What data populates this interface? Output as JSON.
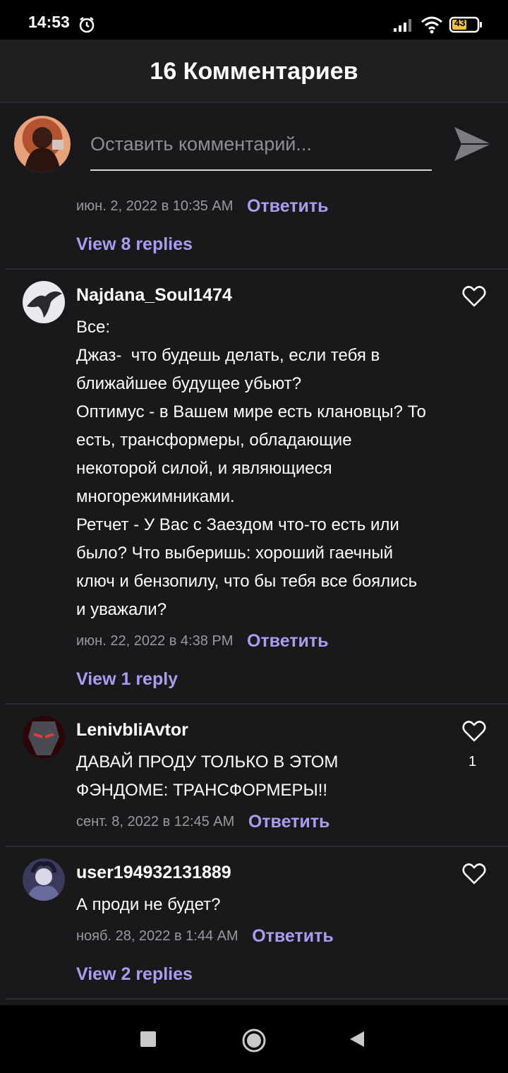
{
  "status_bar": {
    "time": "14:53",
    "battery": "43",
    "icons": [
      "alarm-icon",
      "signal-icon",
      "wifi-icon",
      "battery-icon"
    ]
  },
  "header": {
    "title": "16 Комментариев"
  },
  "composer": {
    "placeholder": "Оставить комментарий..."
  },
  "previous_comment_tail": {
    "date": "июн. 2, 2022 в 10:35 AM",
    "reply_label": "Ответить",
    "view_replies": "View 8 replies"
  },
  "comments": [
    {
      "username": "Najdana_Soul1474",
      "text": "Все:\nДжаз-  что будешь делать, если тебя в ближайшее будущее убьют?\nОптимус - в Вашем мире есть клановцы? То есть, трансформеры, обладающие некоторой силой, и являющиеся многорежимниками.\nРетчет - У Вас с Заездом что-то есть или было? Что выберишь: хороший гаечный ключ и бензопилу, что бы тебя все боялись и уважали?",
      "date": "июн. 22, 2022 в 4:38 PM",
      "reply_label": "Ответить",
      "view_replies": "View 1 reply"
    },
    {
      "username": "LenivbIiAvtor",
      "text": "ДАВАЙ ПРОДУ ТОЛЬКО В ЭТОМ ФЭНДОМЕ: ТРАНСФОРМЕРЫ!!",
      "date": "сент. 8, 2022 в 12:45 AM",
      "reply_label": "Ответить",
      "likes": "1"
    },
    {
      "username": "user194932131889",
      "text": "А проди не будет?",
      "date": "нояб. 28, 2022 в 1:44 AM",
      "reply_label": "Ответить",
      "view_replies": "View 2 replies"
    }
  ],
  "colors": {
    "background": "#19181b",
    "accent": "#a79ef0",
    "meta_text": "#9a999e",
    "divider": "#2c2b2f"
  }
}
